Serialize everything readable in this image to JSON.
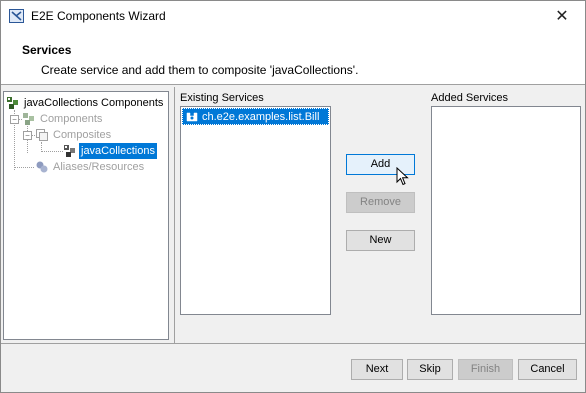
{
  "window": {
    "title": "E2E Components Wizard",
    "close_label": "✕"
  },
  "header": {
    "title": "Services",
    "description": "Create service and add them to composite 'javaCollections'."
  },
  "tree": {
    "root": {
      "label": "javaCollections Components",
      "icon": "components-root-icon"
    },
    "items": [
      {
        "label": "Components",
        "disabled": true,
        "icon": "components-icon"
      },
      {
        "label": "Composites",
        "disabled": true,
        "icon": "composites-icon"
      },
      {
        "label": "javaCollections",
        "selected": true,
        "icon": "composite-node-icon"
      },
      {
        "label": "Aliases/Resources",
        "disabled": true,
        "icon": "aliases-icon"
      }
    ]
  },
  "existing_services": {
    "label": "Existing Services",
    "items": [
      {
        "label": "ch.e2e.examples.list.Bill",
        "selected": true,
        "icon": "service-icon"
      }
    ]
  },
  "added_services": {
    "label": "Added Services",
    "items": []
  },
  "actions": {
    "add": "Add",
    "remove": "Remove",
    "new": "New"
  },
  "footer": {
    "next": "Next",
    "skip": "Skip",
    "finish": "Finish",
    "cancel": "Cancel"
  },
  "colors": {
    "selection": "#0078d7",
    "disabled_text": "#a0a0a0",
    "default_button_border": "#0078d7"
  }
}
